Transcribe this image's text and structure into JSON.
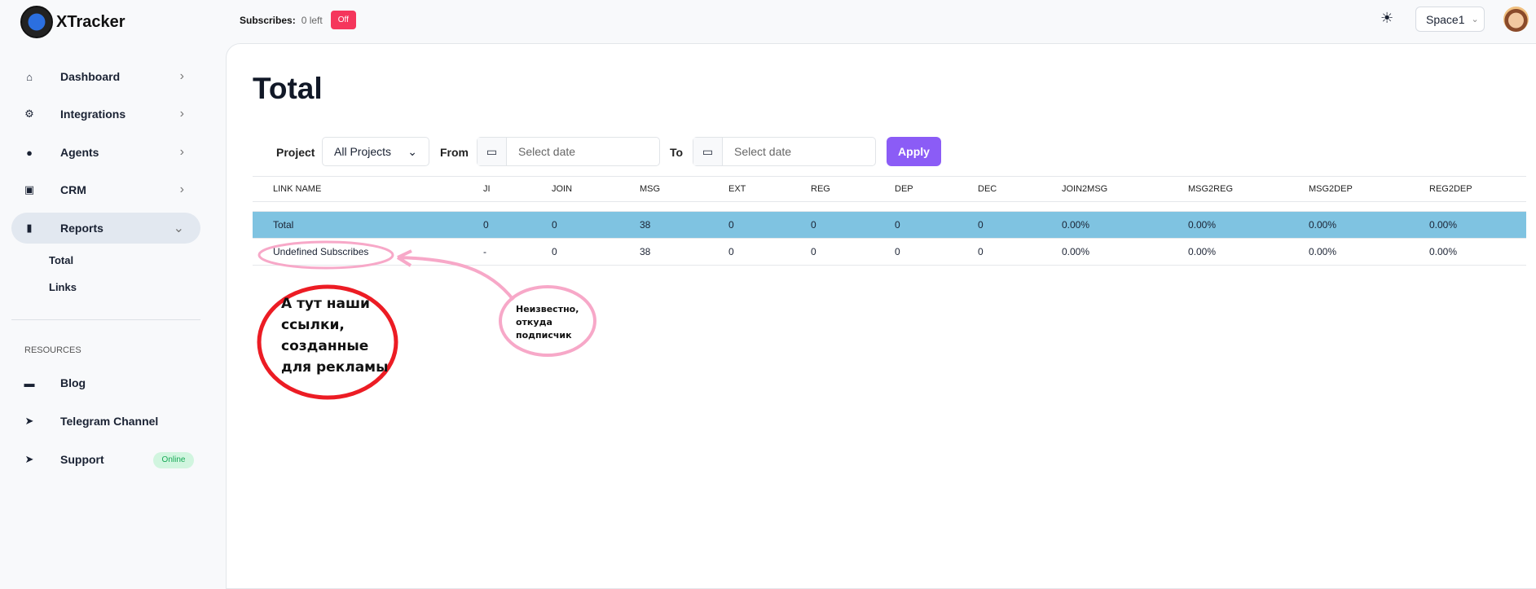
{
  "app": {
    "name": "XTracker"
  },
  "header": {
    "subscribes_label": "Subscribes:",
    "subscribes_left": "0 left",
    "subscribes_toggle": "Off",
    "theme_icon": "sun-icon",
    "space": "Space1"
  },
  "sidebar": {
    "items": [
      {
        "label": "Dashboard",
        "icon": "home-icon"
      },
      {
        "label": "Integrations",
        "icon": "gear-icon"
      },
      {
        "label": "Agents",
        "icon": "user-icon"
      },
      {
        "label": "CRM",
        "icon": "id-card-icon"
      },
      {
        "label": "Reports",
        "icon": "bar-chart-icon"
      }
    ],
    "report_subitems": [
      "Total",
      "Links"
    ],
    "resources_heading": "RESOURCES",
    "resources": [
      {
        "label": "Blog",
        "icon": "book-icon"
      },
      {
        "label": "Telegram Channel",
        "icon": "telegram-icon"
      },
      {
        "label": "Support",
        "icon": "telegram-icon",
        "badge": "Online"
      }
    ]
  },
  "page": {
    "title": "Total"
  },
  "filters": {
    "project_label": "Project",
    "project_value": "All Projects",
    "from_label": "From",
    "from_placeholder": "Select date",
    "to_label": "To",
    "to_placeholder": "Select date",
    "apply": "Apply"
  },
  "table": {
    "columns": [
      "LINK NAME",
      "JI",
      "JOIN",
      "MSG",
      "EXT",
      "REG",
      "DEP",
      "DEC",
      "JOIN2MSG",
      "MSG2REG",
      "MSG2DEP",
      "REG2DEP"
    ],
    "rows": [
      [
        "Total",
        "0",
        "0",
        "38",
        "0",
        "0",
        "0",
        "0",
        "0.00%",
        "0.00%",
        "0.00%",
        "0.00%"
      ],
      [
        "Undefined Subscribes",
        "-",
        "0",
        "38",
        "0",
        "0",
        "0",
        "0",
        "0.00%",
        "0.00%",
        "0.00%",
        "0.00%"
      ]
    ]
  },
  "annotations": {
    "red_note": "А тут наши ссылки, созданные для рекламы",
    "pink_note": "Неизвестно, откуда подписчик"
  }
}
